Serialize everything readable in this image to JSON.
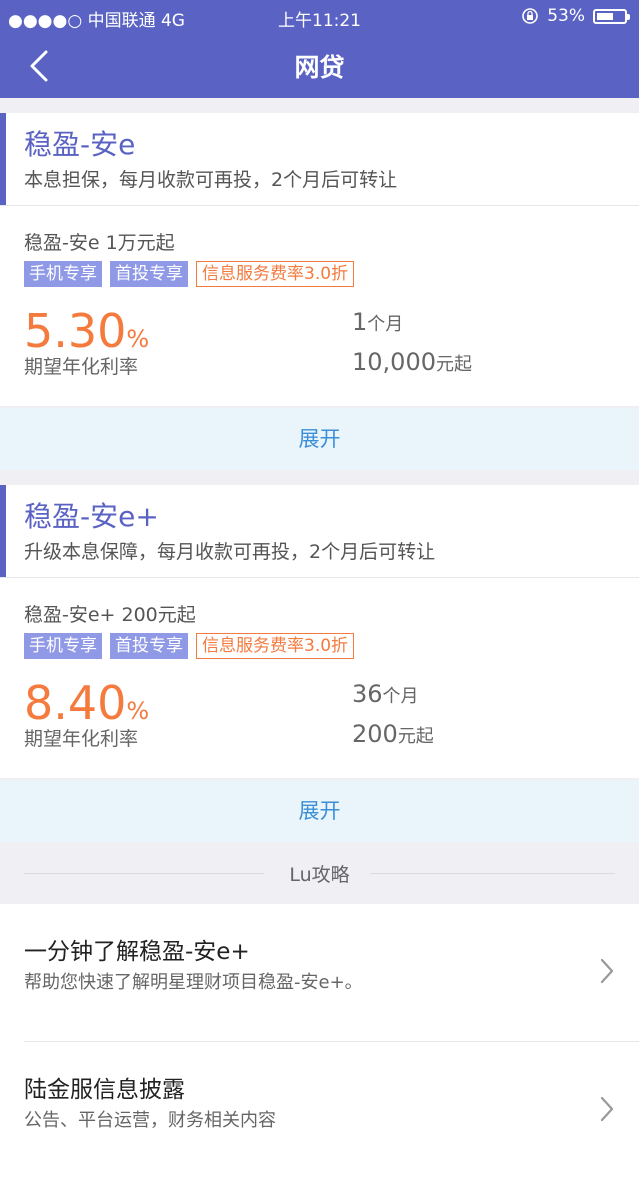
{
  "status_bar": {
    "carrier": "●●●●○ 中国联通  4G",
    "time": "上午11:21",
    "battery": "53%",
    "battery_level": 0.53
  },
  "nav": {
    "title": "网贷"
  },
  "products": [
    {
      "name": "稳盈-安e",
      "desc": "本息担保，每月收款可再投，2个月后可转让",
      "sub": "稳盈-安e  1万元起",
      "tags": [
        "手机专享",
        "首投专享",
        "信息服务费率3.0折"
      ],
      "rate_num": "5.30",
      "rate_unit": "%",
      "rate_label": "期望年化利率",
      "term_num": "1",
      "term_unit": "个月",
      "min_num": "10,000",
      "min_unit": "元起",
      "expand": "展开"
    },
    {
      "name": "稳盈-安e+",
      "desc": "升级本息保障，每月收款可再投，2个月后可转让",
      "sub": "稳盈-安e+  200元起",
      "tags": [
        "手机专享",
        "首投专享",
        "信息服务费率3.0折"
      ],
      "rate_num": "8.40",
      "rate_unit": "%",
      "rate_label": "期望年化利率",
      "term_num": "36",
      "term_unit": "个月",
      "min_num": "200",
      "min_unit": "元起",
      "expand": "展开"
    }
  ],
  "section": {
    "title": "Lu攻略"
  },
  "articles": [
    {
      "title": "一分钟了解稳盈-安e+",
      "desc": "帮助您快速了解明星理财项目稳盈-安e+。"
    },
    {
      "title": "陆金服信息披露",
      "desc": "公告、平台运营，财务相关内容"
    }
  ]
}
